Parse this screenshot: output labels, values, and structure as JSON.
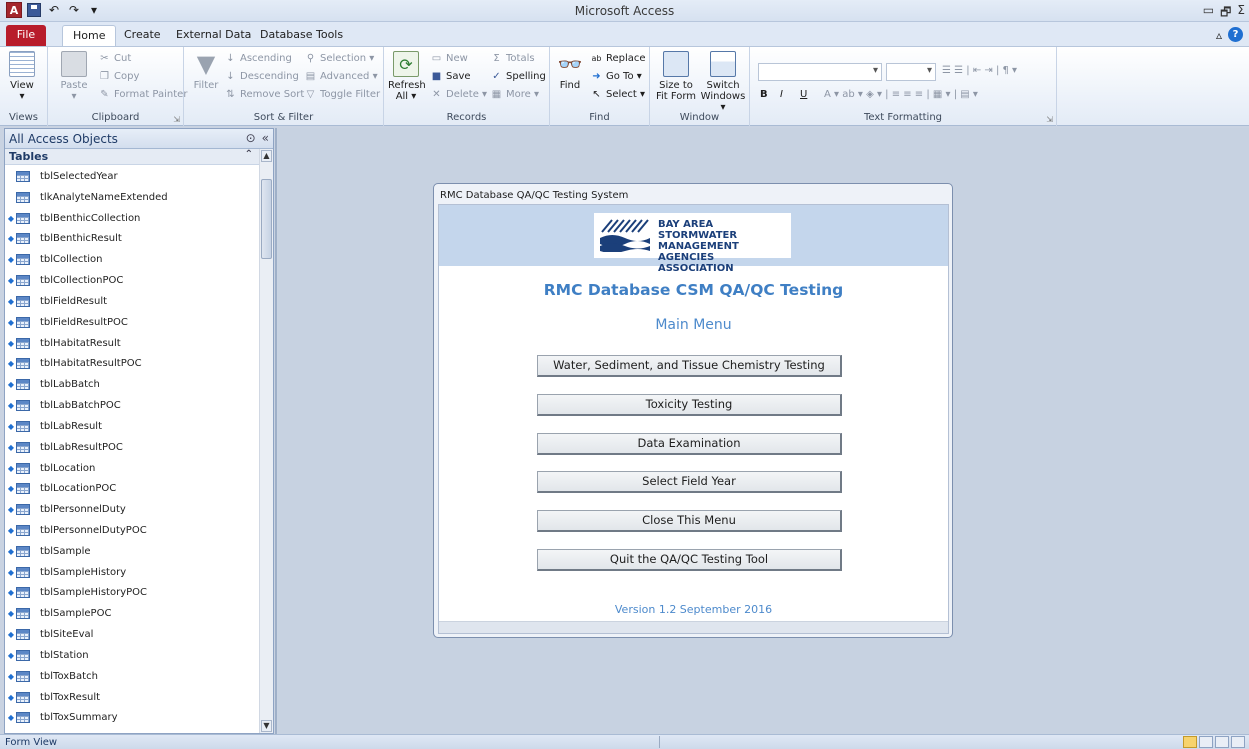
{
  "window": {
    "title": "Microsoft Access",
    "min": "▭",
    "restore": "🗗",
    "close_part": "Σ"
  },
  "tabs": {
    "file": "File",
    "home": "Home",
    "create": "Create",
    "external": "External Data",
    "dbtools": "Database Tools"
  },
  "ribbon": {
    "views": {
      "view": "View",
      "label": "Views"
    },
    "clipboard": {
      "paste": "Paste",
      "cut": "Cut",
      "copy": "Copy",
      "format_painter": "Format Painter",
      "label": "Clipboard"
    },
    "sortfilter": {
      "filter": "Filter",
      "ascending": "Ascending",
      "descending": "Descending",
      "remove_sort": "Remove Sort",
      "selection": "Selection",
      "advanced": "Advanced",
      "toggle_filter": "Toggle Filter",
      "label": "Sort & Filter"
    },
    "records": {
      "refresh": "Refresh",
      "refresh_sub": "All",
      "new": "New",
      "save": "Save",
      "delete": "Delete",
      "totals": "Totals",
      "spelling": "Spelling",
      "more": "More",
      "label": "Records"
    },
    "find": {
      "find": "Find",
      "replace": "Replace",
      "goto": "Go To",
      "select": "Select",
      "label": "Find"
    },
    "window": {
      "size_to_fit": "Size to",
      "size_to_fit_sub": "Fit Form",
      "switch": "Switch",
      "switch_sub": "Windows",
      "label": "Window"
    },
    "textformatting": {
      "bold": "B",
      "italic": "I",
      "underline": "U",
      "font_color": "A",
      "label": "Text Formatting"
    }
  },
  "navpane": {
    "header": "All Access Objects",
    "section": "Tables",
    "items": [
      {
        "name": "tblSelectedYear",
        "star": false
      },
      {
        "name": "tlkAnalyteNameExtended",
        "star": false
      },
      {
        "name": "tblBenthicCollection",
        "star": true
      },
      {
        "name": "tblBenthicResult",
        "star": true
      },
      {
        "name": "tblCollection",
        "star": true
      },
      {
        "name": "tblCollectionPOC",
        "star": true
      },
      {
        "name": "tblFieldResult",
        "star": true
      },
      {
        "name": "tblFieldResultPOC",
        "star": true
      },
      {
        "name": "tblHabitatResult",
        "star": true
      },
      {
        "name": "tblHabitatResultPOC",
        "star": true
      },
      {
        "name": "tblLabBatch",
        "star": true
      },
      {
        "name": "tblLabBatchPOC",
        "star": true
      },
      {
        "name": "tblLabResult",
        "star": true
      },
      {
        "name": "tblLabResultPOC",
        "star": true
      },
      {
        "name": "tblLocation",
        "star": true
      },
      {
        "name": "tblLocationPOC",
        "star": true
      },
      {
        "name": "tblPersonnelDuty",
        "star": true
      },
      {
        "name": "tblPersonnelDutyPOC",
        "star": true
      },
      {
        "name": "tblSample",
        "star": true
      },
      {
        "name": "tblSampleHistory",
        "star": true
      },
      {
        "name": "tblSampleHistoryPOC",
        "star": true
      },
      {
        "name": "tblSamplePOC",
        "star": true
      },
      {
        "name": "tblSiteEval",
        "star": true
      },
      {
        "name": "tblStation",
        "star": true
      },
      {
        "name": "tblToxBatch",
        "star": true
      },
      {
        "name": "tblToxResult",
        "star": true
      },
      {
        "name": "tblToxSummary",
        "star": true
      }
    ]
  },
  "form": {
    "window_title": "RMC Database QA/QC Testing System",
    "logo": {
      "line1": "BAY AREA",
      "line2": "STORMWATER MANAGEMENT",
      "line3": "AGENCIES ASSOCIATION"
    },
    "title": "RMC Database CSM QA/QC Testing",
    "subtitle": "Main Menu",
    "buttons": [
      "Water, Sediment, and Tissue Chemistry Testing",
      "Toxicity Testing",
      "Data Examination",
      "Select Field Year",
      "Close This Menu",
      "Quit the QA/QC Testing Tool"
    ],
    "version": "Version 1.2 September 2016"
  },
  "statusbar": {
    "mode": "Form View"
  },
  "colors": {
    "file_tab": "#b81c2b",
    "form_title": "#3f7fc4",
    "form_header": "#c4d6ec"
  }
}
